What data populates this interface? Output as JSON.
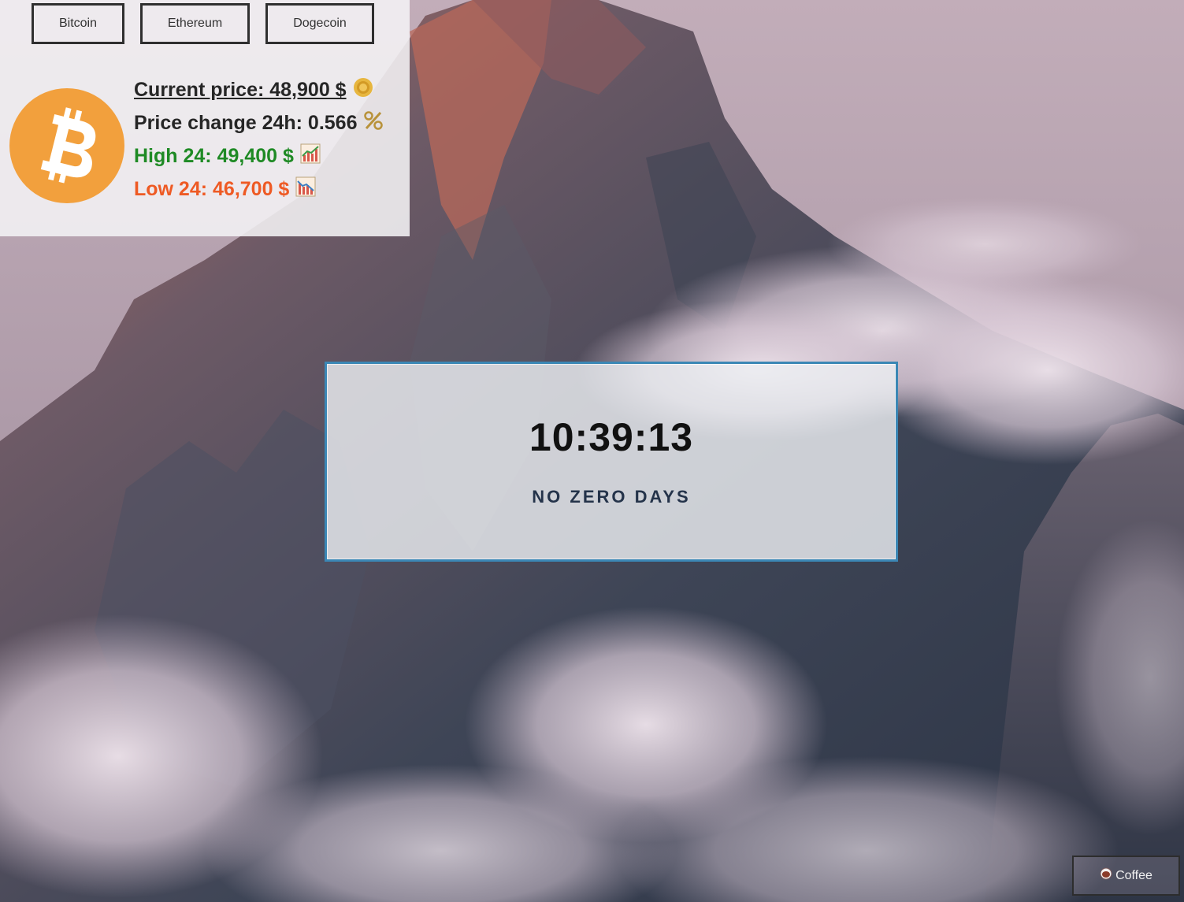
{
  "crypto": {
    "tabs": [
      {
        "label": "Bitcoin"
      },
      {
        "label": "Ethereum"
      },
      {
        "label": "Dogecoin"
      }
    ],
    "selected_coin_icon": "bitcoin-logo-icon",
    "current_price": "Current price: 48,900 $",
    "price_change": "Price change 24h: 0.566",
    "high_24": "High 24: 49,400 $",
    "low_24": "Low 24: 46,700 $",
    "colors": {
      "bitcoin_orange": "#f2a03d",
      "high": "#1f8a25",
      "low": "#ee5a24"
    }
  },
  "clock": {
    "time": "10:39:13",
    "motto": "NO ZERO DAYS",
    "border_color": "#3b87b5"
  },
  "footer": {
    "coffee_label": "Coffee",
    "coffee_icon": "coffee-cup-icon"
  }
}
